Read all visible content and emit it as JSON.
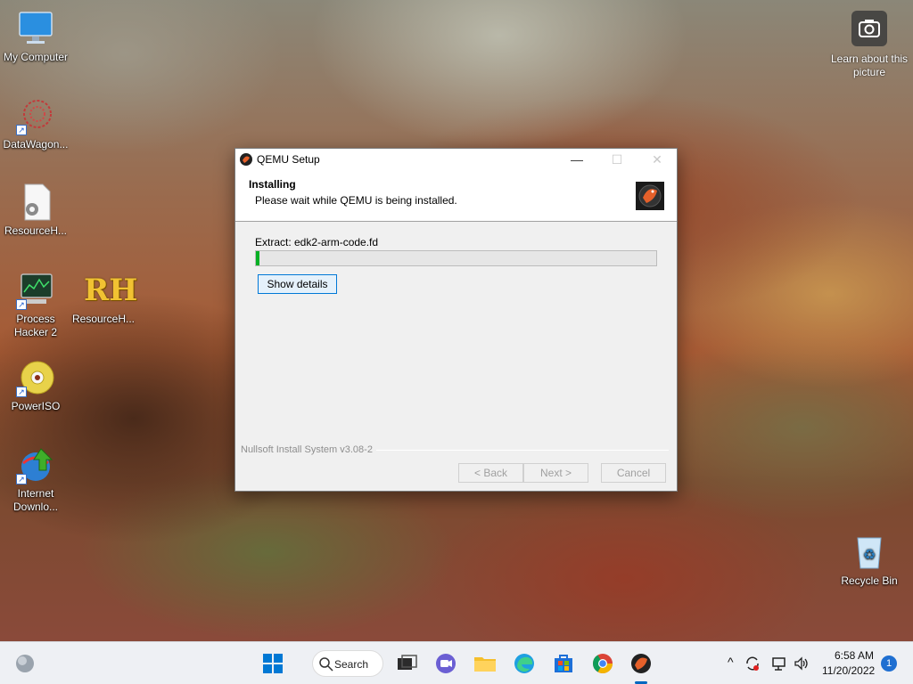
{
  "desktop": {
    "icons": [
      {
        "label": "My Computer"
      },
      {
        "label": "DataWagon..."
      },
      {
        "label": "ResourceH..."
      },
      {
        "label": "Process Hacker 2"
      },
      {
        "label": "ResourceH...",
        "logo": "RH"
      },
      {
        "label": "PowerISO"
      },
      {
        "label": "Internet Downlo..."
      },
      {
        "label": "Recycle Bin"
      }
    ],
    "camera_text": "Learn about this picture"
  },
  "dialog": {
    "title": "QEMU Setup",
    "header_title": "Installing",
    "header_subtitle": "Please wait while QEMU is being installed.",
    "extract_label": "Extract: edk2-arm-code.fd",
    "progress": 0.01,
    "show_details_label": "Show details",
    "nsis_label": "Nullsoft Install System v3.08-2",
    "back_label": "< Back",
    "next_label": "Next >",
    "cancel_label": "Cancel",
    "minimize_glyph": "—",
    "maximize_glyph": "☐",
    "close_glyph": "✕"
  },
  "taskbar": {
    "search_label": "Search",
    "time": "6:58 AM",
    "date": "11/20/2022",
    "notification_count": "1",
    "tray_chevron": "^"
  },
  "colors": {
    "accent": "#0078d7",
    "progress_fill": "#06b025"
  }
}
